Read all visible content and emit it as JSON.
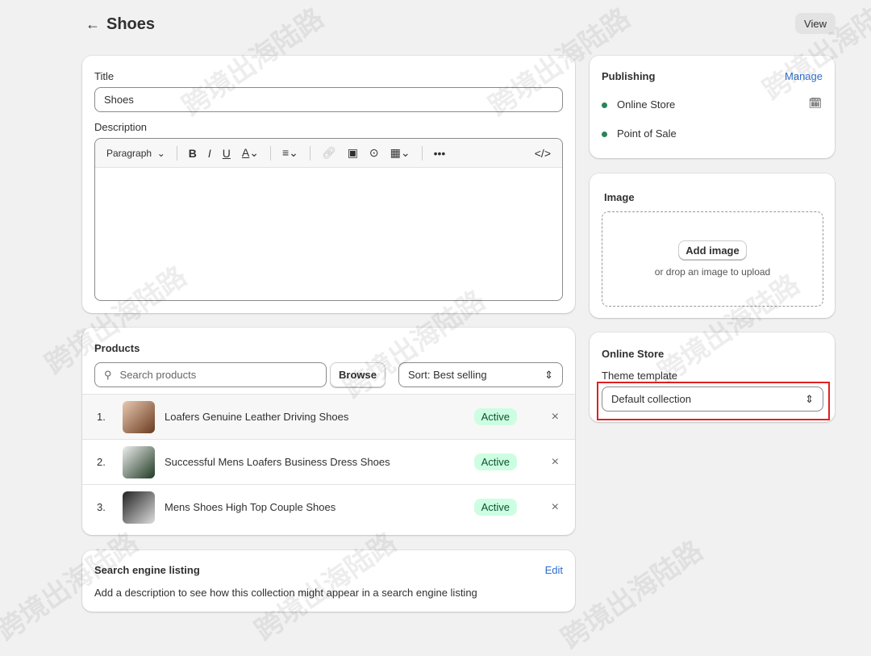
{
  "header": {
    "title": "Shoes",
    "view_label": "View"
  },
  "title_field": {
    "label": "Title",
    "value": "Shoes"
  },
  "description": {
    "label": "Description",
    "paragraph": "Paragraph"
  },
  "products": {
    "heading": "Products",
    "search_placeholder": "Search products",
    "browse_label": "Browse",
    "sort_value": "Sort: Best selling",
    "items": [
      {
        "num": "1.",
        "name": "Loafers Genuine Leather Driving Shoes",
        "status": "Active"
      },
      {
        "num": "2.",
        "name": "Successful Mens Loafers Business Dress Shoes",
        "status": "Active"
      },
      {
        "num": "3.",
        "name": "Mens Shoes High Top Couple Shoes",
        "status": "Active"
      }
    ]
  },
  "seo": {
    "heading": "Search engine listing",
    "edit_label": "Edit",
    "text": "Add a description to see how this collection might appear in a search engine listing"
  },
  "publishing": {
    "heading": "Publishing",
    "manage_label": "Manage",
    "channels": [
      "Online Store",
      "Point of Sale"
    ]
  },
  "image": {
    "heading": "Image",
    "add_label": "Add image",
    "hint": "or drop an image to upload"
  },
  "online_store": {
    "heading": "Online Store",
    "template_label": "Theme template",
    "template_value": "Default collection"
  },
  "watermark": "跨境出海陆路",
  "colors": {
    "accent": "#2c6ecb",
    "highlight": "#e02020"
  }
}
